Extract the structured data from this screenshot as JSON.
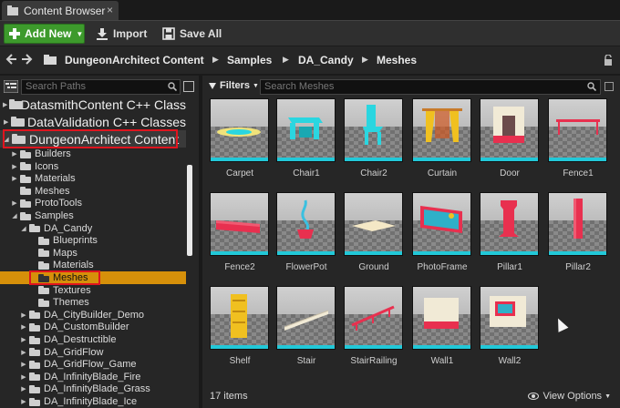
{
  "window": {
    "tab_title": "Content Browser",
    "close_glyph": "×"
  },
  "toolbar": {
    "add_new_label": "Add New",
    "import_label": "Import",
    "save_all_label": "Save All"
  },
  "pathbar": {
    "crumbs": [
      "DungeonArchitect Content",
      "Samples",
      "DA_Candy",
      "Meshes"
    ]
  },
  "sources": {
    "search_placeholder": "Search Paths",
    "tree": [
      {
        "label": "DatasmithContent C++ Class",
        "level": 0,
        "size": "large",
        "expanded": false,
        "icon": "cpp-folder-icon"
      },
      {
        "label": "DataValidation C++ Classes",
        "level": 0,
        "size": "large",
        "expanded": false,
        "icon": "cpp-folder-icon"
      },
      {
        "label": "DungeonArchitect Content",
        "level": 0,
        "size": "large",
        "expanded": true,
        "highlighted": true
      },
      {
        "label": "Builders",
        "level": 1,
        "size": "small",
        "expanded": false
      },
      {
        "label": "Icons",
        "level": 1,
        "size": "small",
        "expanded": false
      },
      {
        "label": "Materials",
        "level": 1,
        "size": "small",
        "expanded": false
      },
      {
        "label": "Meshes",
        "level": 1,
        "size": "small",
        "expanded": null
      },
      {
        "label": "ProtoTools",
        "level": 1,
        "size": "small",
        "expanded": false
      },
      {
        "label": "Samples",
        "level": 1,
        "size": "small",
        "expanded": true
      },
      {
        "label": "DA_Candy",
        "level": 2,
        "size": "small",
        "expanded": true
      },
      {
        "label": "Blueprints",
        "level": 3,
        "size": "small",
        "expanded": null
      },
      {
        "label": "Maps",
        "level": 3,
        "size": "small",
        "expanded": null
      },
      {
        "label": "Materials",
        "level": 3,
        "size": "small",
        "expanded": null
      },
      {
        "label": "Meshes",
        "level": 3,
        "size": "small",
        "expanded": null,
        "selected": true
      },
      {
        "label": "Textures",
        "level": 3,
        "size": "small",
        "expanded": null
      },
      {
        "label": "Themes",
        "level": 3,
        "size": "small",
        "expanded": null
      },
      {
        "label": "DA_CityBuilder_Demo",
        "level": 2,
        "size": "small",
        "expanded": false
      },
      {
        "label": "DA_CustomBuilder",
        "level": 2,
        "size": "small",
        "expanded": false
      },
      {
        "label": "DA_Destructible",
        "level": 2,
        "size": "small",
        "expanded": false
      },
      {
        "label": "DA_GridFlow",
        "level": 2,
        "size": "small",
        "expanded": false
      },
      {
        "label": "DA_GridFlow_Game",
        "level": 2,
        "size": "small",
        "expanded": false
      },
      {
        "label": "DA_InfinityBlade_Fire",
        "level": 2,
        "size": "small",
        "expanded": false
      },
      {
        "label": "DA_InfinityBlade_Grass",
        "level": 2,
        "size": "small",
        "expanded": false
      },
      {
        "label": "DA_InfinityBlade_Ice",
        "level": 2,
        "size": "small",
        "expanded": false
      }
    ]
  },
  "assets": {
    "filters_label": "Filters",
    "search_placeholder": "Search Meshes",
    "items": [
      {
        "name": "Carpet",
        "kind": "carpet"
      },
      {
        "name": "Chair1",
        "kind": "chair1"
      },
      {
        "name": "Chair2",
        "kind": "chair2"
      },
      {
        "name": "Curtain",
        "kind": "curtain"
      },
      {
        "name": "Door",
        "kind": "door"
      },
      {
        "name": "Fence1",
        "kind": "fence1"
      },
      {
        "name": "Fence2",
        "kind": "fence2"
      },
      {
        "name": "FlowerPot",
        "kind": "flowerpot"
      },
      {
        "name": "Ground",
        "kind": "ground"
      },
      {
        "name": "PhotoFrame",
        "kind": "photoframe"
      },
      {
        "name": "Pillar1",
        "kind": "pillar1"
      },
      {
        "name": "Pillar2",
        "kind": "pillar2"
      },
      {
        "name": "Shelf",
        "kind": "shelf"
      },
      {
        "name": "Stair",
        "kind": "stair"
      },
      {
        "name": "StairRailing",
        "kind": "stairrailing"
      },
      {
        "name": "Wall1",
        "kind": "wall1"
      },
      {
        "name": "Wall2",
        "kind": "wall2"
      }
    ],
    "item_count": "17 items",
    "view_options_label": "View Options"
  },
  "colors": {
    "accent_green": "#3d9a2c",
    "selection_orange": "#d6900a",
    "asset_bar_cyan": "#22c8d8",
    "annotation_red": "#e0141e"
  }
}
